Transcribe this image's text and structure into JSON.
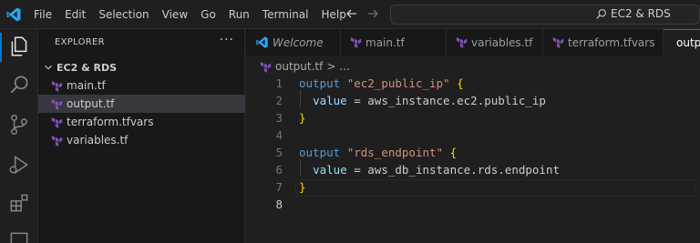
{
  "menu": [
    "File",
    "Edit",
    "Selection",
    "View",
    "Go",
    "Run",
    "Terminal",
    "Help"
  ],
  "search": {
    "text": "EC2 & RDS"
  },
  "colors": {
    "accent": "#0078d4",
    "terraform": "#844fba",
    "vscode_blue": "#23a9f2"
  },
  "activity_icons": [
    "explorer-icon",
    "search-icon",
    "source-control-icon",
    "run-debug-icon",
    "extensions-icon",
    "remote-icon"
  ],
  "sidebar": {
    "title": "EXPLORER",
    "more": "···",
    "folder": "EC2 & RDS",
    "files": [
      {
        "name": "main.tf",
        "selected": false
      },
      {
        "name": "output.tf",
        "selected": true
      },
      {
        "name": "terraform.tfvars",
        "selected": false
      },
      {
        "name": "variables.tf",
        "selected": false
      }
    ]
  },
  "tabs": [
    {
      "label": "Welcome",
      "italic": true
    },
    {
      "label": "main.tf"
    },
    {
      "label": "variables.tf"
    },
    {
      "label": "terraform.tfvars"
    },
    {
      "label": "outp",
      "active": true
    }
  ],
  "breadcrumb": {
    "file": "output.tf",
    "sep": ">",
    "more": "..."
  },
  "editor": {
    "current_line": 8,
    "lines": [
      {
        "n": "1",
        "tokens": [
          [
            "kw",
            "output"
          ],
          [
            "txt",
            " "
          ],
          [
            "str",
            "\"ec2_public_ip\""
          ],
          [
            "txt",
            " "
          ],
          [
            "brace",
            "{"
          ]
        ]
      },
      {
        "n": "2",
        "tokens": [
          [
            "txt",
            "  "
          ],
          [
            "attr",
            "value"
          ],
          [
            "txt",
            " = aws_instance.ec2.public_ip"
          ]
        ]
      },
      {
        "n": "3",
        "tokens": [
          [
            "brace",
            "}"
          ]
        ]
      },
      {
        "n": "4",
        "tokens": []
      },
      {
        "n": "5",
        "tokens": [
          [
            "kw",
            "output"
          ],
          [
            "txt",
            " "
          ],
          [
            "str",
            "\"rds_endpoint\""
          ],
          [
            "txt",
            " "
          ],
          [
            "brace",
            "{"
          ]
        ]
      },
      {
        "n": "6",
        "tokens": [
          [
            "txt",
            "  "
          ],
          [
            "attr",
            "value"
          ],
          [
            "txt",
            " = aws_db_instance.rds.endpoint"
          ]
        ]
      },
      {
        "n": "7",
        "tokens": [
          [
            "brace",
            "}"
          ]
        ]
      },
      {
        "n": "8",
        "tokens": []
      }
    ]
  }
}
